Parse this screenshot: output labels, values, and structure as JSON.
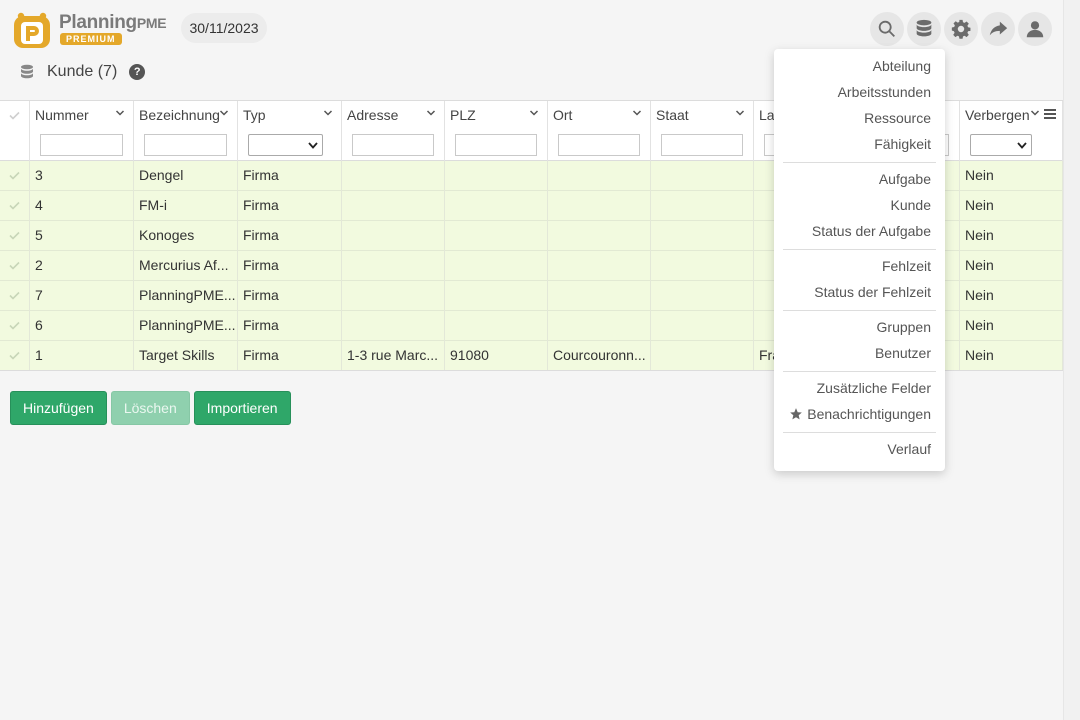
{
  "header": {
    "logo_text_planning": "Planning",
    "logo_text_pme": "PME",
    "logo_badge": "PREMIUM",
    "date": "30/11/2023",
    "icons": [
      "search-icon",
      "database-icon",
      "gear-icon",
      "share-icon",
      "user-icon"
    ]
  },
  "breadcrumb": {
    "title": "Kunde (7)",
    "help": "?"
  },
  "grid": {
    "columns": [
      {
        "label": "Nummer",
        "filter": "text"
      },
      {
        "label": "Bezeichnung",
        "filter": "text"
      },
      {
        "label": "Typ",
        "filter": "select"
      },
      {
        "label": "Adresse",
        "filter": "text"
      },
      {
        "label": "PLZ",
        "filter": "text"
      },
      {
        "label": "Ort",
        "filter": "text"
      },
      {
        "label": "Staat",
        "filter": "text"
      },
      {
        "label": "La",
        "filter": "text"
      },
      {
        "label": "",
        "filter": "text"
      },
      {
        "label": "Verbergen",
        "filter": "select"
      }
    ],
    "rows": [
      [
        "3",
        "Dengel",
        "Firma",
        "",
        "",
        "",
        "",
        "",
        "",
        "Nein"
      ],
      [
        "4",
        "FM-i",
        "Firma",
        "",
        "",
        "",
        "",
        "",
        "",
        "Nein"
      ],
      [
        "5",
        "Konoges",
        "Firma",
        "",
        "",
        "",
        "",
        "",
        "",
        "Nein"
      ],
      [
        "2",
        "Mercurius Af...",
        "Firma",
        "",
        "",
        "",
        "",
        "",
        "",
        "Nein"
      ],
      [
        "7",
        "PlanningPME...",
        "Firma",
        "",
        "",
        "",
        "",
        "",
        "",
        "Nein"
      ],
      [
        "6",
        "PlanningPME...",
        "Firma",
        "",
        "",
        "",
        "",
        "",
        "",
        "Nein"
      ],
      [
        "1",
        "Target Skills",
        "Firma",
        "1-3 rue Marc...",
        "91080",
        "Courcouronn...",
        "",
        "Fra",
        "...",
        "Nein"
      ]
    ]
  },
  "buttons": {
    "add": "Hinzufügen",
    "delete": "Löschen",
    "import": "Importieren"
  },
  "menu": {
    "items": [
      "Abteilung",
      "Arbeitsstunden",
      "Ressource",
      "Fähigkeit",
      "Aufgabe",
      "Kunde",
      "Status der Aufgabe",
      "Fehlzeit",
      "Status der Fehlzeit",
      "Gruppen",
      "Benutzer",
      "Zusätzliche Felder",
      "Benachrichtigungen",
      "Verlauf"
    ]
  },
  "colors": {
    "accent_green": "#2fa769",
    "row_bg": "#f2fadf",
    "logo_orange": "#e4a82a"
  }
}
